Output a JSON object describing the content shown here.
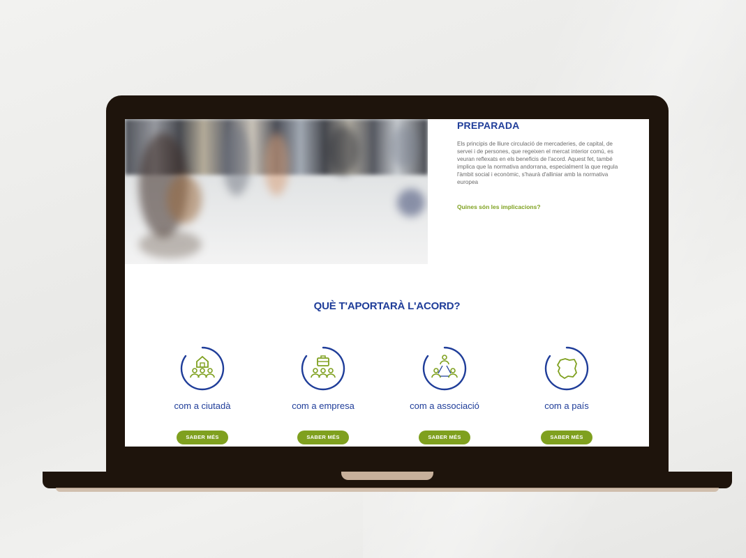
{
  "section": {
    "title": "PREPARADA",
    "body": "Els principis de lliure circulació de mercaderies, de capital, de servei i de persones, que regeixen el mercat interior comú, es veuran reflexats en els beneficis de l'acord. Aquest fet, també implica que la normativa andorrana, especialment la que regula l'àmbit social i econòmic, s'haurà d'alliniar amb la normativa europea",
    "link": "Quines són les implicacions?"
  },
  "benefits": {
    "title": "QUÈ T'APORTARÀ L'ACORD?",
    "cards": [
      {
        "label": "com a ciutadà",
        "button": "SABER MÉS",
        "icon": "house-people-icon"
      },
      {
        "label": "com a empresa",
        "button": "SABER MÉS",
        "icon": "briefcase-people-icon"
      },
      {
        "label": "com a associació",
        "button": "SABER MÉS",
        "icon": "network-people-icon"
      },
      {
        "label": "com a país",
        "button": "SABER MÉS",
        "icon": "country-map-icon"
      }
    ]
  },
  "colors": {
    "brand_blue": "#1f3d99",
    "accent_green": "#7fa01f",
    "laptop_frame": "#1e140c"
  }
}
